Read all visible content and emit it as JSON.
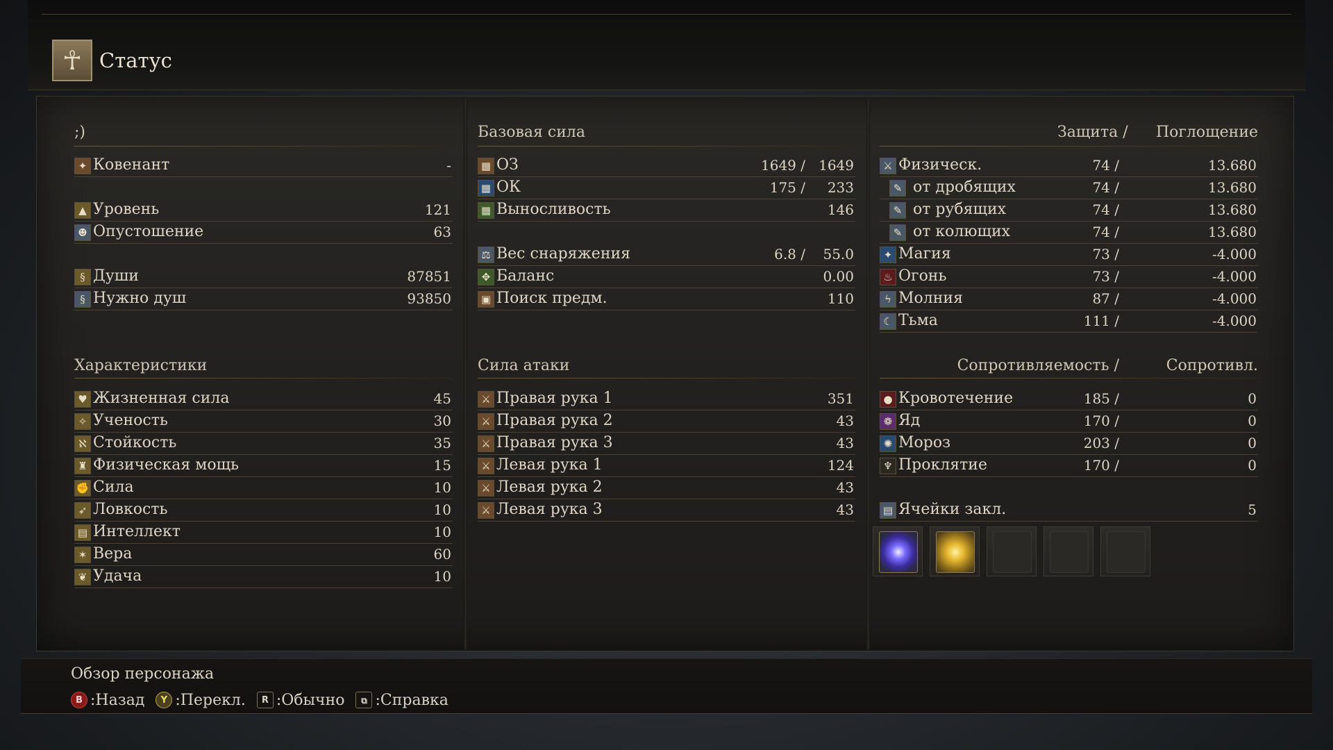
{
  "header": {
    "title": "Статус",
    "icon": "character-figure-icon"
  },
  "player": {
    "name": ";)"
  },
  "summary": [
    {
      "label": "Ковенант",
      "value": "-",
      "icon": "covenant-icon"
    },
    {
      "label": "Уровень",
      "value": "121",
      "icon": "level-icon"
    },
    {
      "label": "Опустошение",
      "value": "63",
      "icon": "hollowing-icon"
    },
    {
      "label": "Души",
      "value": "87851",
      "icon": "souls-icon"
    },
    {
      "label": "Нужно душ",
      "value": "93850",
      "icon": "souls-needed-icon"
    }
  ],
  "attributes": {
    "title": "Характеристики",
    "items": [
      {
        "label": "Жизненная сила",
        "value": "45"
      },
      {
        "label": "Ученость",
        "value": "30"
      },
      {
        "label": "Стойкость",
        "value": "35"
      },
      {
        "label": "Физическая мощь",
        "value": "15"
      },
      {
        "label": "Сила",
        "value": "10"
      },
      {
        "label": "Ловкость",
        "value": "10"
      },
      {
        "label": "Интеллект",
        "value": "10"
      },
      {
        "label": "Вера",
        "value": "60"
      },
      {
        "label": "Удача",
        "value": "10"
      }
    ]
  },
  "base_power": {
    "title": "Базовая сила",
    "items": [
      {
        "label": "ОЗ",
        "current": "1649 /",
        "max": "1649",
        "icon": "hp-icon"
      },
      {
        "label": "ОК",
        "current": "175 /",
        "max": "233",
        "icon": "fp-icon"
      },
      {
        "label": "Выносливость",
        "value": "146",
        "icon": "stamina-icon"
      },
      {
        "label": "Вес снаряжения",
        "current": "6.8 /",
        "max": "55.0",
        "icon": "equip-load-icon"
      },
      {
        "label": "Баланс",
        "value": "0.00",
        "icon": "poise-icon"
      },
      {
        "label": "Поиск предм.",
        "value": "110",
        "icon": "item-discovery-icon"
      }
    ]
  },
  "attack": {
    "title": "Сила атаки",
    "items": [
      {
        "label": "Правая рука 1",
        "value": "351"
      },
      {
        "label": "Правая рука 2",
        "value": "43"
      },
      {
        "label": "Правая рука 3",
        "value": "43"
      },
      {
        "label": "Левая рука 1",
        "value": "124"
      },
      {
        "label": "Левая рука 2",
        "value": "43"
      },
      {
        "label": "Левая рука 3",
        "value": "43"
      }
    ]
  },
  "defense": {
    "header_left": "Защита /",
    "header_right": "Поглощение",
    "items": [
      {
        "label": "Физическ.",
        "def": "74 /",
        "abs": "13.680",
        "sub": false,
        "icon": "physical-def-icon"
      },
      {
        "label": "от дробящих",
        "def": "74 /",
        "abs": "13.680",
        "sub": true,
        "icon": "strike-def-icon"
      },
      {
        "label": "от рубящих",
        "def": "74 /",
        "abs": "13.680",
        "sub": true,
        "icon": "slash-def-icon"
      },
      {
        "label": "от колющих",
        "def": "74 /",
        "abs": "13.680",
        "sub": true,
        "icon": "thrust-def-icon"
      },
      {
        "label": "Магия",
        "def": "73 /",
        "abs": "-4.000",
        "sub": false,
        "icon": "magic-def-icon"
      },
      {
        "label": "Огонь",
        "def": "73 /",
        "abs": "-4.000",
        "sub": false,
        "icon": "fire-def-icon"
      },
      {
        "label": "Молния",
        "def": "87 /",
        "abs": "-4.000",
        "sub": false,
        "icon": "lightning-def-icon"
      },
      {
        "label": "Тьма",
        "def": "111 /",
        "abs": "-4.000",
        "sub": false,
        "icon": "dark-def-icon"
      }
    ]
  },
  "resistance": {
    "header_left": "Сопротивляемость /",
    "header_right": "Сопротивл.",
    "items": [
      {
        "label": "Кровотечение",
        "res": "185 /",
        "val": "0",
        "icon": "bleed-icon"
      },
      {
        "label": "Яд",
        "res": "170 /",
        "val": "0",
        "icon": "poison-icon"
      },
      {
        "label": "Мороз",
        "res": "203 /",
        "val": "0",
        "icon": "frost-icon"
      },
      {
        "label": "Проклятие",
        "res": "170 /",
        "val": "0",
        "icon": "curse-icon"
      }
    ]
  },
  "attunement": {
    "label": "Ячейки закл.",
    "value": "5",
    "slots": [
      "magic-spell",
      "miracle-spell",
      "empty",
      "empty",
      "empty"
    ]
  },
  "footer": {
    "title": "Обзор персонажа",
    "hints": [
      {
        "button": "B",
        "text": ":Назад"
      },
      {
        "button": "Y",
        "text": ":Перекл."
      },
      {
        "button": "R",
        "text": ":Обычно"
      },
      {
        "button": "⧉",
        "text": ":Справка"
      }
    ]
  }
}
